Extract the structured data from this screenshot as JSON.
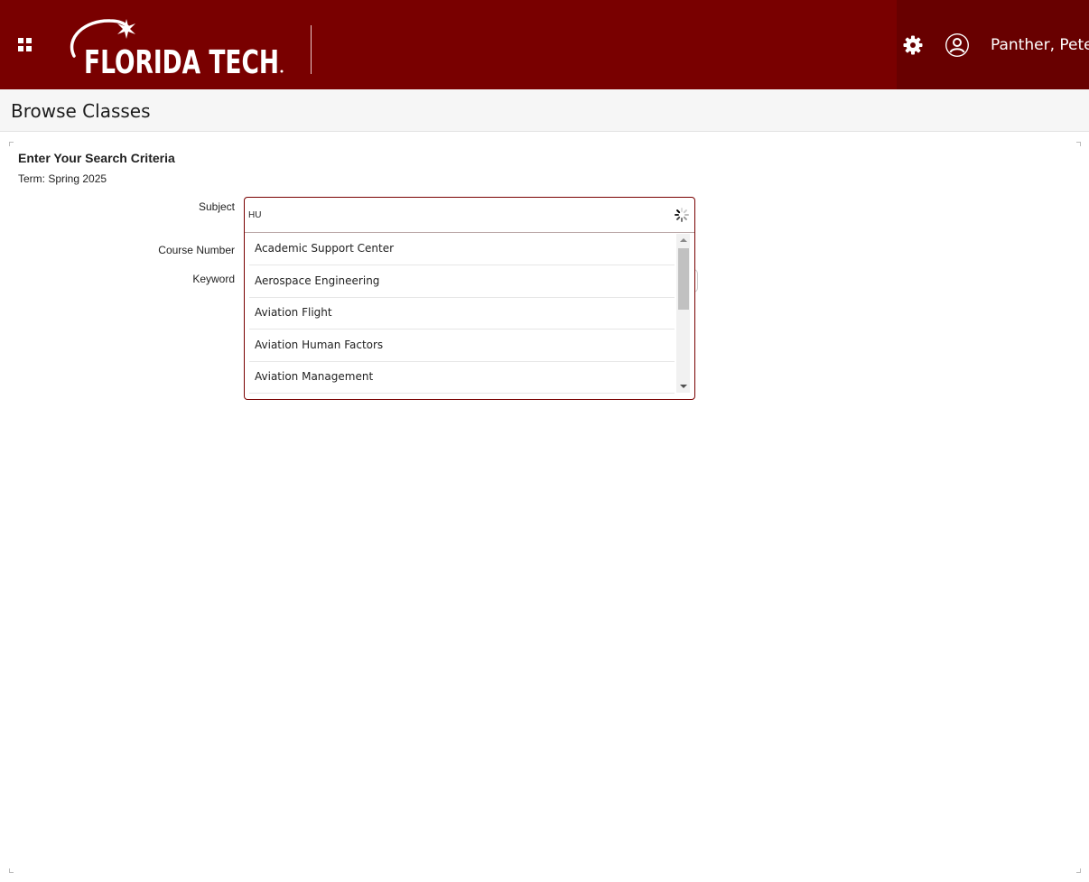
{
  "header": {
    "logo_text": "FLORIDA TECH",
    "user_name": "Panther, Pete",
    "colors": {
      "brand": "#790000",
      "brand_dark": "#680000"
    }
  },
  "page": {
    "title": "Browse Classes"
  },
  "search": {
    "heading": "Enter Your Search Criteria",
    "term_label": "Term:",
    "term_value": "Spring 2025",
    "subject_label": "Subject",
    "subject_value": "HU",
    "course_number_label": "Course Number",
    "keyword_label": "Keyword"
  },
  "subject_dropdown": {
    "options": [
      "Academic Support Center",
      "Aerospace Engineering",
      "Aviation Flight",
      "Aviation Human Factors",
      "Aviation Management"
    ]
  }
}
